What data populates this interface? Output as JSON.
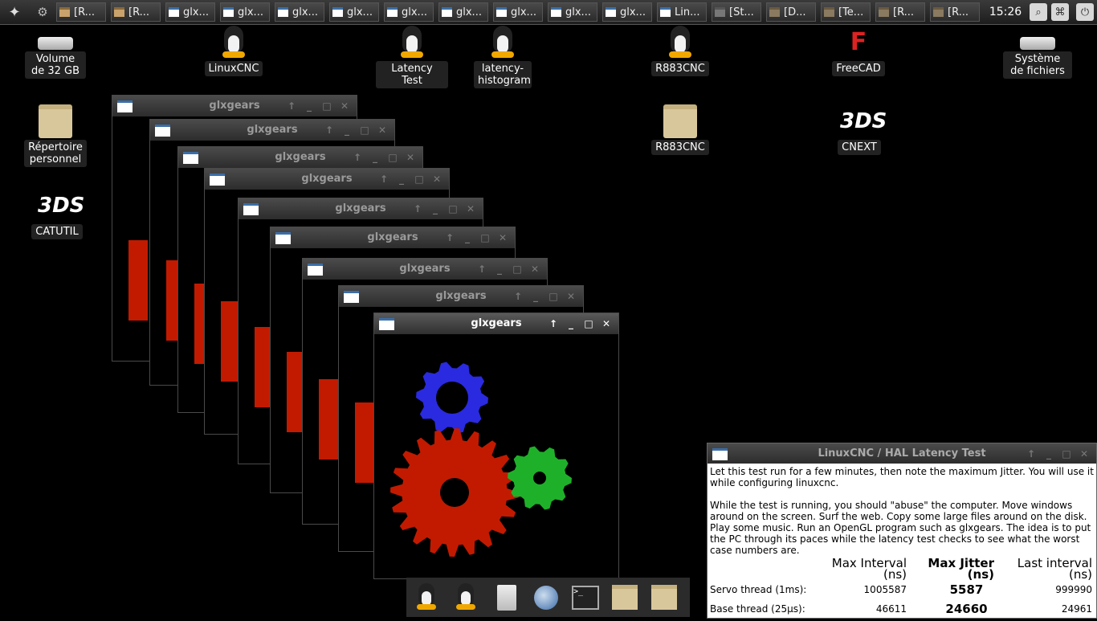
{
  "taskbar": {
    "tasks": [
      {
        "label": "[R...",
        "icon": "edit"
      },
      {
        "label": "[R...",
        "icon": "edit"
      },
      {
        "label": "glx...",
        "icon": "window"
      },
      {
        "label": "glx...",
        "icon": "window"
      },
      {
        "label": "glx...",
        "icon": "window"
      },
      {
        "label": "glx...",
        "icon": "window"
      },
      {
        "label": "glx...",
        "icon": "window"
      },
      {
        "label": "glx...",
        "icon": "window"
      },
      {
        "label": "glx...",
        "icon": "window"
      },
      {
        "label": "glx...",
        "icon": "window"
      },
      {
        "label": "glx...",
        "icon": "window"
      },
      {
        "label": "Lin...",
        "icon": "window"
      },
      {
        "label": "[St...",
        "icon": "term"
      },
      {
        "label": "[D...",
        "icon": "folder"
      },
      {
        "label": "[Te...",
        "icon": "folder"
      },
      {
        "label": "[R...",
        "icon": "folder"
      },
      {
        "label": "[R...",
        "icon": "folder"
      }
    ],
    "clock": "15:26"
  },
  "desktop": {
    "volume": "Volume de 32 GB",
    "linuxcnc": "LinuxCNC",
    "latency_test": "Latency Test",
    "latency_histogram": "latency-histogram",
    "r883cnc": "R883CNC",
    "freecad": "FreeCAD",
    "systeme": "Système de fichiers",
    "repertoire": "Répertoire personnel",
    "r883cnc_folder": "R883CNC",
    "cnext": "CNEXT",
    "catutil": "CATUTIL",
    "ds_glyph": "3DS",
    "fc_glyph": "F"
  },
  "glx_title": "glxgears",
  "latency": {
    "title": "LinuxCNC / HAL Latency Test",
    "intro": "Let this test run for a few minutes, then note the maximum Jitter.  You will use it while configuring linuxcnc.",
    "body": "While the test is running, you should \"abuse\" the computer. Move windows around on the screen. Surf the web. Copy some large files around on the disk. Play some music. Run an OpenGL program such as glxgears. The idea is to put the PC through its paces while the latency test checks to see what the worst case numbers are.",
    "headers": {
      "max_interval": "Max Interval (ns)",
      "max_jitter": "Max Jitter (ns)",
      "last_interval": "Last interval (ns)"
    },
    "servo": {
      "label": "Servo thread (1ms):",
      "max_interval": "1005587",
      "max_jitter": "5587",
      "last_interval": "999990"
    },
    "base": {
      "label": "Base thread (25µs):",
      "max_interval": "46611",
      "max_jitter": "24660",
      "last_interval": "24961"
    }
  },
  "colors": {
    "gear_red": "#c21a00",
    "gear_green": "#1fb02a",
    "gear_blue": "#2a2ae0",
    "taskbar": "#2a2a2a"
  }
}
